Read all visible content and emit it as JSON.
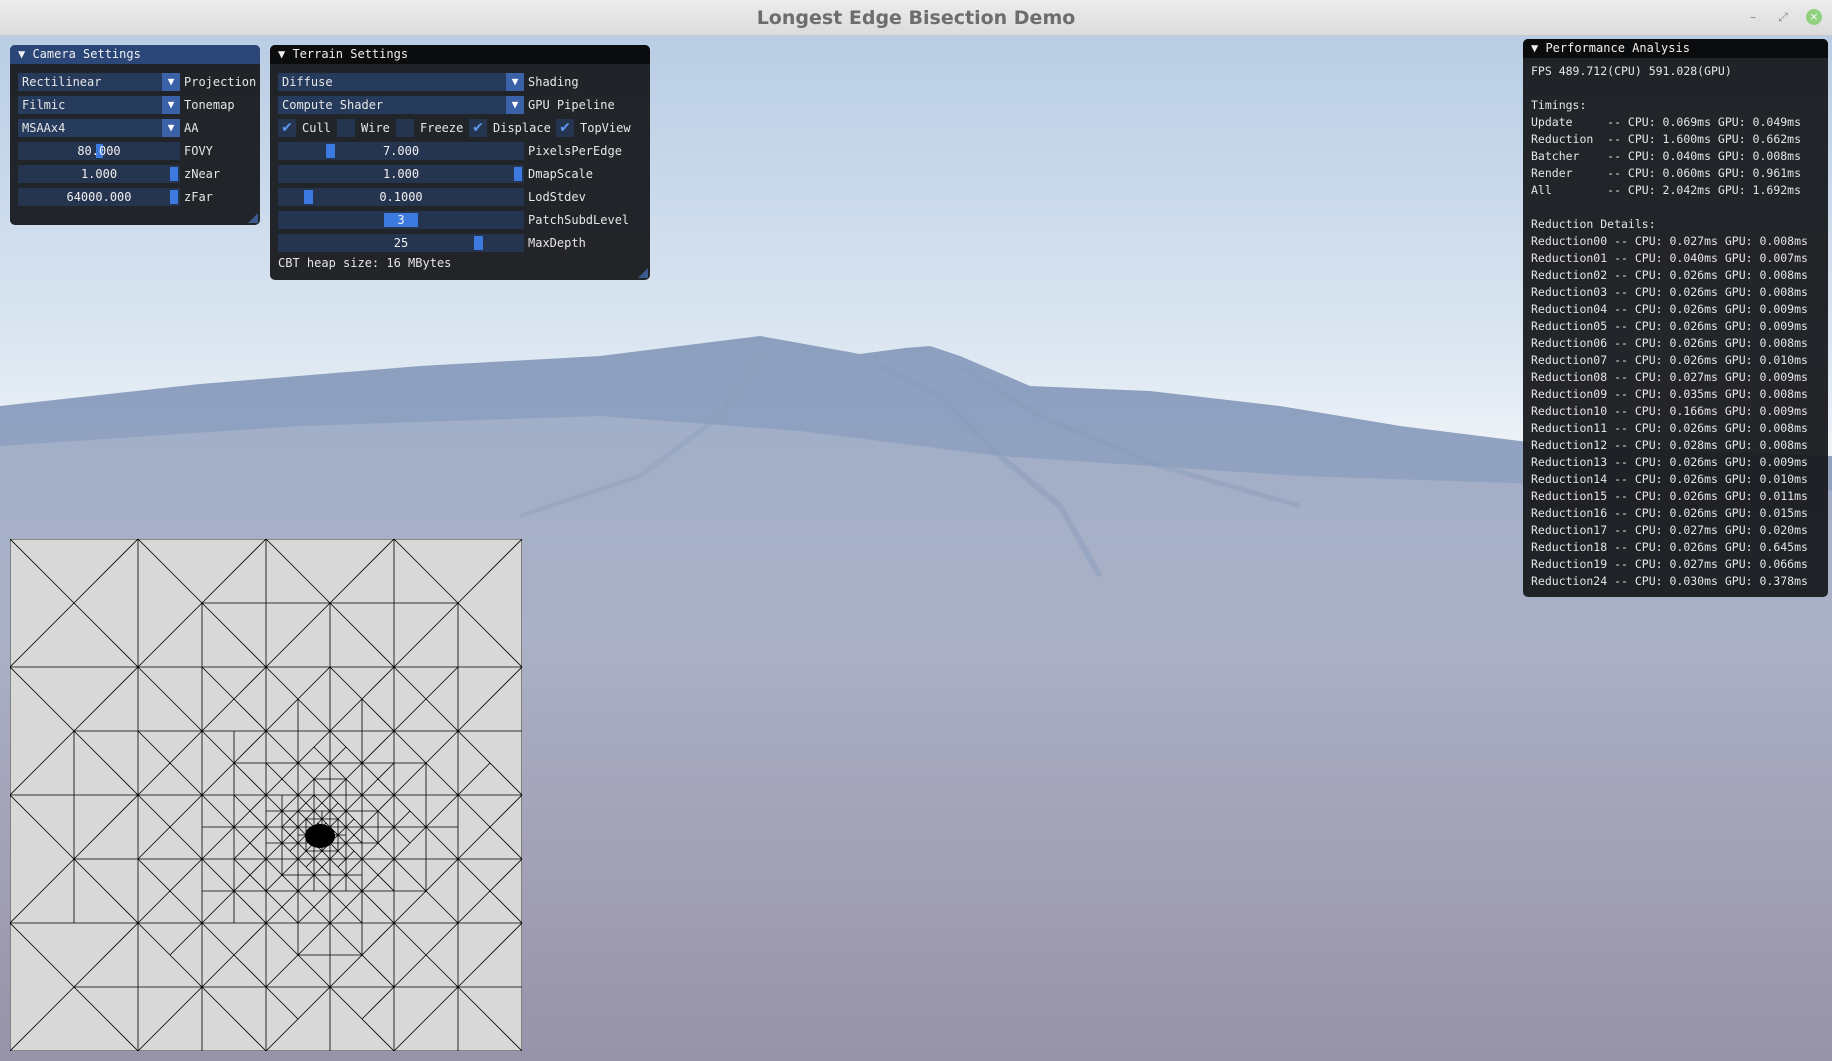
{
  "window": {
    "title": "Longest Edge Bisection Demo",
    "minimize_icon": "minimize-icon",
    "restore_icon": "restore-icon",
    "close_icon": "close-icon"
  },
  "camera_panel": {
    "title": "Camera Settings",
    "projection": {
      "value": "Rectilinear",
      "label": "Projection"
    },
    "tonemap": {
      "value": "Filmic",
      "label": "Tonemap"
    },
    "aa": {
      "value": "MSAAx4",
      "label": "AA"
    },
    "fovy": {
      "value": "80.000",
      "label": "FOVY"
    },
    "znear": {
      "value": "1.000",
      "label": "zNear"
    },
    "zfar": {
      "value": "64000.000",
      "label": "zFar"
    }
  },
  "terrain_panel": {
    "title": "Terrain Settings",
    "shading": {
      "value": "Diffuse",
      "label": "Shading"
    },
    "pipeline": {
      "value": "Compute Shader",
      "label": "GPU Pipeline"
    },
    "checks": [
      {
        "label": "Cull",
        "checked": true
      },
      {
        "label": "Wire",
        "checked": false
      },
      {
        "label": "Freeze",
        "checked": false
      },
      {
        "label": "Displace",
        "checked": true
      },
      {
        "label": "TopView",
        "checked": true
      }
    ],
    "pixels_per_edge": {
      "value": "7.000",
      "label": "PixelsPerEdge",
      "fraction": 0.2
    },
    "dmap_scale": {
      "value": "1.000",
      "label": "DmapScale",
      "fraction": 1.0
    },
    "lod_stdev": {
      "value": "0.1000",
      "label": "LodStdev",
      "fraction": 0.1
    },
    "patch_subd_level": {
      "value": "3",
      "label": "PatchSubdLevel",
      "fraction": 0.5
    },
    "max_depth": {
      "value": "25",
      "label": "MaxDepth",
      "fraction": 0.83
    },
    "heap_size": "CBT heap size: 16 MBytes"
  },
  "perf_panel": {
    "title": "Performance Analysis",
    "fps": "FPS 489.712(CPU) 591.028(GPU)",
    "timings_header": "Timings:",
    "timings": [
      "Update     -- CPU: 0.069ms GPU: 0.049ms",
      "Reduction  -- CPU: 1.600ms GPU: 0.662ms",
      "Batcher    -- CPU: 0.040ms GPU: 0.008ms",
      "Render     -- CPU: 0.060ms GPU: 0.961ms",
      "All        -- CPU: 2.042ms GPU: 1.692ms"
    ],
    "details_header": "Reduction Details:",
    "details": [
      "Reduction00 -- CPU: 0.027ms GPU: 0.008ms",
      "Reduction01 -- CPU: 0.040ms GPU: 0.007ms",
      "Reduction02 -- CPU: 0.026ms GPU: 0.008ms",
      "Reduction03 -- CPU: 0.026ms GPU: 0.008ms",
      "Reduction04 -- CPU: 0.026ms GPU: 0.009ms",
      "Reduction05 -- CPU: 0.026ms GPU: 0.009ms",
      "Reduction06 -- CPU: 0.026ms GPU: 0.008ms",
      "Reduction07 -- CPU: 0.026ms GPU: 0.010ms",
      "Reduction08 -- CPU: 0.027ms GPU: 0.009ms",
      "Reduction09 -- CPU: 0.035ms GPU: 0.008ms",
      "Reduction10 -- CPU: 0.166ms GPU: 0.009ms",
      "Reduction11 -- CPU: 0.026ms GPU: 0.008ms",
      "Reduction12 -- CPU: 0.028ms GPU: 0.008ms",
      "Reduction13 -- CPU: 0.026ms GPU: 0.009ms",
      "Reduction14 -- CPU: 0.026ms GPU: 0.010ms",
      "Reduction15 -- CPU: 0.026ms GPU: 0.011ms",
      "Reduction16 -- CPU: 0.026ms GPU: 0.015ms",
      "Reduction17 -- CPU: 0.027ms GPU: 0.020ms",
      "Reduction18 -- CPU: 0.026ms GPU: 0.645ms",
      "Reduction19 -- CPU: 0.027ms GPU: 0.066ms",
      "Reduction24 -- CPU: 0.030ms GPU: 0.378ms"
    ]
  },
  "colors": {
    "panel_bg": "#16181c",
    "active_title": "#2a4778",
    "accent": "#3d7ae0",
    "frame": "#253550"
  }
}
